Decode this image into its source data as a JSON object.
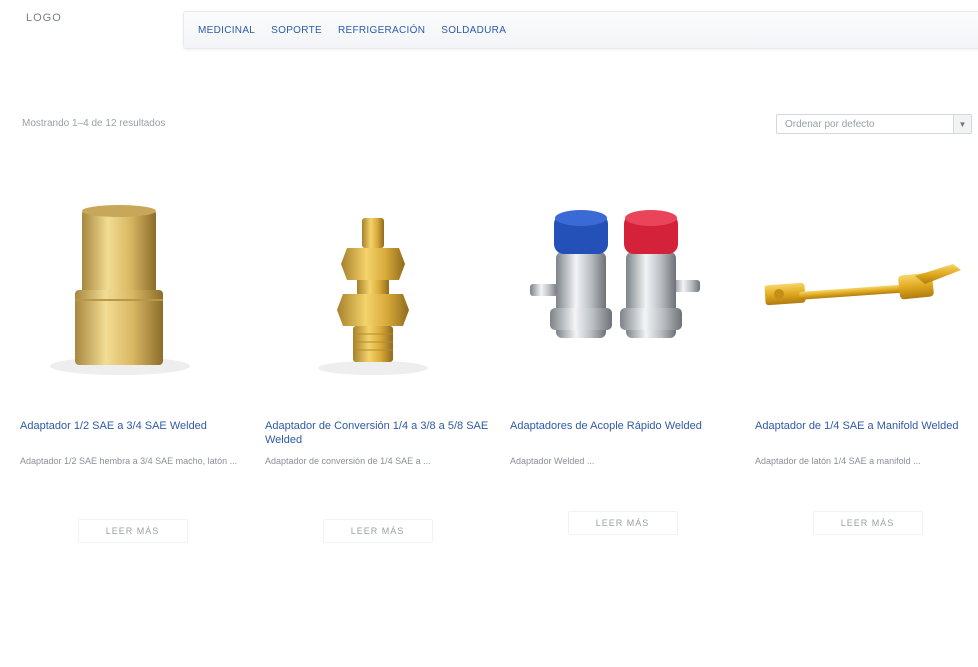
{
  "header": {
    "logo_text": "LOGO",
    "nav": [
      "MEDICINAL",
      "SOPORTE",
      "REFRIGERACIÓN",
      "SOLDADURA"
    ]
  },
  "toolbar": {
    "result_count": "Mostrando 1–4 de 12 resultados",
    "sort_placeholder": "Ordenar por defecto"
  },
  "products": [
    {
      "title": "Adaptador 1/2 SAE a 3/4 SAE Welded",
      "excerpt": "Adaptador 1/2 SAE hembra a 3/4 SAE macho, latón ...",
      "button": "LEER MÁS",
      "icon": "brass-coupling-icon"
    },
    {
      "title": "Adaptador de Conversión 1/4 a 3/8 a 5/8 SAE Welded",
      "excerpt": "Adaptador de conversión de 1/4 SAE a ...",
      "button": "LEER MÁS",
      "icon": "brass-valve-fitting-icon"
    },
    {
      "title": "Adaptadores de Acople Rápido Welded",
      "excerpt": "Adaptador Welded ...",
      "button": "LEER MÁS",
      "icon": "quick-coupler-icon"
    },
    {
      "title": "Adaptador de 1/4 SAE a Manifold Welded",
      "excerpt": "Adaptador de latón 1/4 SAE a manifold ...",
      "button": "LEER MÁS",
      "icon": "brass-wrench-icon"
    }
  ]
}
